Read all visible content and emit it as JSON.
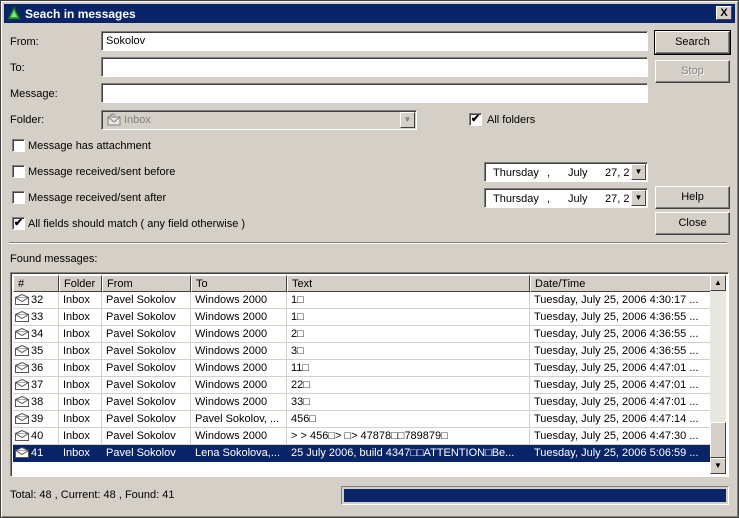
{
  "window": {
    "title": "Seach in messages",
    "close_glyph": "X"
  },
  "form": {
    "from_label": "From:",
    "from_value": "Sokolov",
    "to_label": "To:",
    "to_value": "",
    "message_label": "Message:",
    "message_value": "",
    "folder_label": "Folder:",
    "folder_value": "Inbox",
    "all_folders_label": "All folders",
    "all_folders_checked": true,
    "attachment_label": "Message has attachment",
    "attachment_checked": false,
    "before_label": "Message received/sent before",
    "before_checked": false,
    "after_label": "Message received/sent after",
    "after_checked": false,
    "all_fields_label": "All fields should match ( any field otherwise )",
    "all_fields_checked": true,
    "date_before": {
      "day": "Thursday",
      "sep": ",",
      "month": "July",
      "date": "27, 2"
    },
    "date_after": {
      "day": "Thursday",
      "sep": ",",
      "month": "July",
      "date": "27, 2"
    }
  },
  "buttons": {
    "search": "Search",
    "stop": "Stop",
    "help": "Help",
    "close": "Close"
  },
  "results": {
    "label": "Found messages:",
    "columns": [
      "#",
      "Folder",
      "From",
      "To",
      "Text",
      "Date/Time"
    ],
    "rows": [
      {
        "n": "32",
        "folder": "Inbox",
        "from": "Pavel Sokolov",
        "to": "Windows 2000",
        "text": "1□",
        "date": "Tuesday, July 25, 2006 4:30:17 ..."
      },
      {
        "n": "33",
        "folder": "Inbox",
        "from": "Pavel Sokolov",
        "to": "Windows 2000",
        "text": "1□",
        "date": "Tuesday, July 25, 2006 4:36:55 ..."
      },
      {
        "n": "34",
        "folder": "Inbox",
        "from": "Pavel Sokolov",
        "to": "Windows 2000",
        "text": "2□",
        "date": "Tuesday, July 25, 2006 4:36:55 ..."
      },
      {
        "n": "35",
        "folder": "Inbox",
        "from": "Pavel Sokolov",
        "to": "Windows 2000",
        "text": "3□",
        "date": "Tuesday, July 25, 2006 4:36:55 ..."
      },
      {
        "n": "36",
        "folder": "Inbox",
        "from": "Pavel Sokolov",
        "to": "Windows 2000",
        "text": "11□",
        "date": "Tuesday, July 25, 2006 4:47:01 ..."
      },
      {
        "n": "37",
        "folder": "Inbox",
        "from": "Pavel Sokolov",
        "to": "Windows 2000",
        "text": "22□",
        "date": "Tuesday, July 25, 2006 4:47:01 ..."
      },
      {
        "n": "38",
        "folder": "Inbox",
        "from": "Pavel Sokolov",
        "to": "Windows 2000",
        "text": "33□",
        "date": "Tuesday, July 25, 2006 4:47:01 ..."
      },
      {
        "n": "39",
        "folder": "Inbox",
        "from": "Pavel Sokolov",
        "to": "Pavel Sokolov, ...",
        "text": "456□",
        "date": "Tuesday, July 25, 2006 4:47:14 ..."
      },
      {
        "n": "40",
        "folder": "Inbox",
        "from": "Pavel Sokolov",
        "to": "Windows 2000",
        "text": "> > 456□> □> 47878□□789879□",
        "date": "Tuesday, July 25, 2006 4:47:30 ..."
      },
      {
        "n": "41",
        "folder": "Inbox",
        "from": "Pavel Sokolov",
        "to": "Lena Sokolova,...",
        "text": "25 July 2006, build 4347□□ATTENTION□Be...",
        "date": "Tuesday, July 25, 2006 5:06:59 ...",
        "selected": true
      }
    ]
  },
  "status": {
    "text": "Total: 48 , Current: 48 , Found: 41",
    "progress": 1.0
  },
  "colors": {
    "selection": "#0a246a",
    "face": "#d4d0c8"
  },
  "icons": {
    "app": "green-triangle-icon",
    "folder": "inbox-icon",
    "message": "envelope-icon"
  }
}
